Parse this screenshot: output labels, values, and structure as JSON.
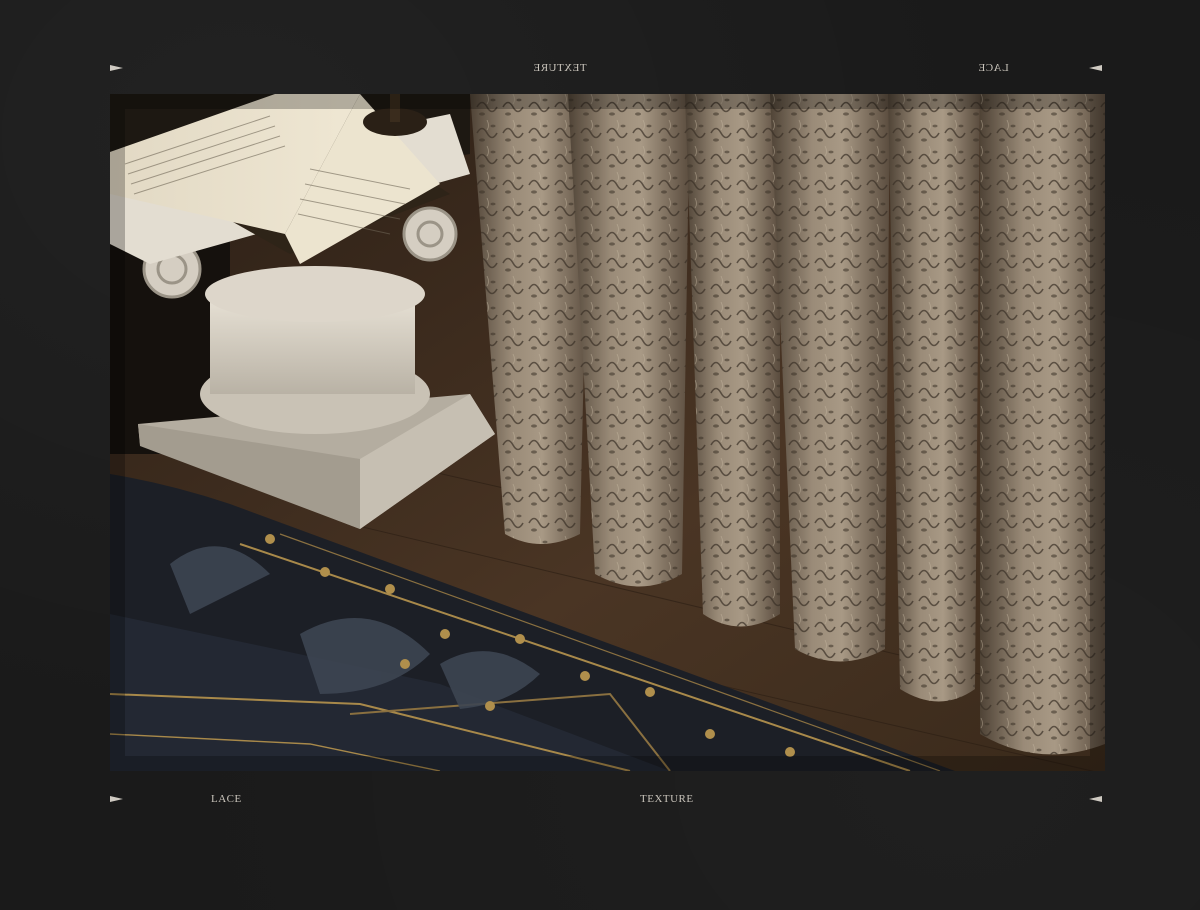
{
  "top_bar": {
    "center_label": "TEXTURE",
    "right_label": "LACE"
  },
  "bottom_bar": {
    "left_label": "LACE",
    "center_label": "TEXTURE"
  },
  "photo": {
    "palette": {
      "background": "#1a1a1a",
      "floor": "#3a2b1e",
      "lace": "#8c7e6e",
      "rug": "#1e2128",
      "gold": "#a8894a",
      "plaster": "#d8d2c6"
    }
  }
}
